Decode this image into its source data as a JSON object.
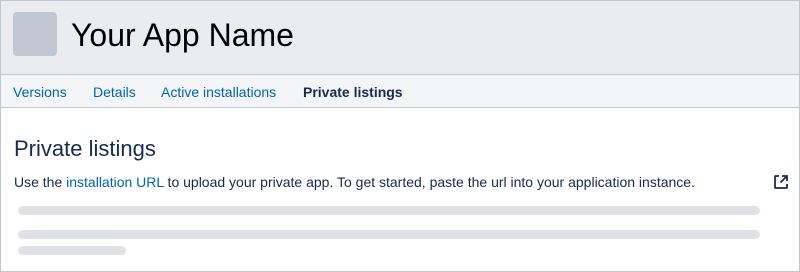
{
  "header": {
    "app_name": "Your App Name"
  },
  "tabs": [
    {
      "label": "Versions",
      "active": false
    },
    {
      "label": "Details",
      "active": false
    },
    {
      "label": "Active installations",
      "active": false
    },
    {
      "label": "Private listings",
      "active": true
    }
  ],
  "main": {
    "title": "Private listings",
    "description": {
      "before": "Use the ",
      "link_text": "installation URL",
      "after": " to upload your private app. To get started, paste the url into your application instance."
    },
    "external_link_icon": "external-link-icon"
  },
  "colors": {
    "link": "#0065b0",
    "header_bg": "#ebecf0",
    "placeholder": "#dfe1e6"
  }
}
